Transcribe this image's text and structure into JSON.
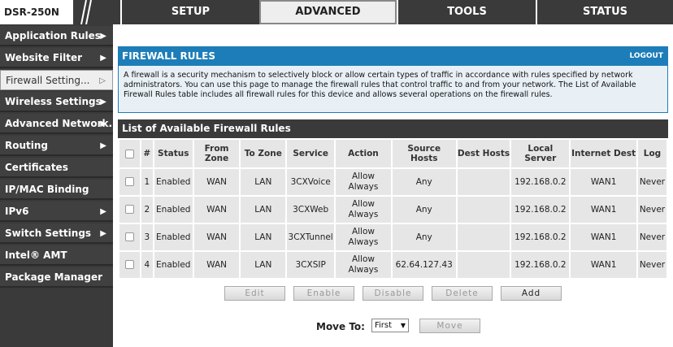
{
  "app": {
    "model": "DSR-250N"
  },
  "nav": {
    "tabs": [
      {
        "label": "SETUP",
        "active": false
      },
      {
        "label": "ADVANCED",
        "active": true
      },
      {
        "label": "TOOLS",
        "active": false
      },
      {
        "label": "STATUS",
        "active": false
      }
    ]
  },
  "sidebar": {
    "items": [
      {
        "label": "Application Rules",
        "arrow": "▶"
      },
      {
        "label": "Website Filter",
        "arrow": "▶"
      },
      {
        "label": "Firewall Setting...",
        "arrow": "▷"
      },
      {
        "label": "Wireless Settings",
        "arrow": "▶"
      },
      {
        "label": "Advanced Network...",
        "arrow": "▶"
      },
      {
        "label": "Routing",
        "arrow": "▶"
      },
      {
        "label": "Certificates",
        "arrow": ""
      },
      {
        "label": "IP/MAC Binding",
        "arrow": ""
      },
      {
        "label": "IPv6",
        "arrow": "▶"
      },
      {
        "label": "Switch Settings",
        "arrow": "▶"
      },
      {
        "label": "Intel® AMT",
        "arrow": ""
      },
      {
        "label": "Package Manager",
        "arrow": ""
      }
    ]
  },
  "main": {
    "title": "FIREWALL RULES",
    "logout": "LOGOUT",
    "description": "A firewall is a security mechanism to selectively block or allow certain types of traffic in accordance with rules specified by network administrators. You can use this page to manage the firewall rules that control traffic to and from your network. The List of Available Firewall Rules table includes all firewall rules for this device and allows several operations on the firewall rules.",
    "list_title": "List of Available Firewall Rules",
    "columns": [
      "#",
      "Status",
      "From Zone",
      "To Zone",
      "Service",
      "Action",
      "Source Hosts",
      "Dest Hosts",
      "Local Server",
      "Internet Dest",
      "Log"
    ],
    "rows": [
      {
        "num": "1",
        "status": "Enabled",
        "from": "WAN",
        "to": "LAN",
        "service": "3CXVoice",
        "action": "Allow Always",
        "source": "Any",
        "dest": "",
        "local": "192.168.0.2",
        "internet": "WAN1",
        "log": "Never"
      },
      {
        "num": "2",
        "status": "Enabled",
        "from": "WAN",
        "to": "LAN",
        "service": "3CXWeb",
        "action": "Allow Always",
        "source": "Any",
        "dest": "",
        "local": "192.168.0.2",
        "internet": "WAN1",
        "log": "Never"
      },
      {
        "num": "3",
        "status": "Enabled",
        "from": "WAN",
        "to": "LAN",
        "service": "3CXTunnel",
        "action": "Allow Always",
        "source": "Any",
        "dest": "",
        "local": "192.168.0.2",
        "internet": "WAN1",
        "log": "Never"
      },
      {
        "num": "4",
        "status": "Enabled",
        "from": "WAN",
        "to": "LAN",
        "service": "3CXSIP",
        "action": "Allow Always",
        "source": "62.64.127.43",
        "dest": "",
        "local": "192.168.0.2",
        "internet": "WAN1",
        "log": "Never"
      }
    ],
    "buttons": {
      "edit": "Edit",
      "enable": "Enable",
      "disable": "Disable",
      "delete": "Delete",
      "add": "Add"
    },
    "move_to": {
      "label": "Move To:",
      "selected": "First",
      "button": "Move"
    }
  }
}
